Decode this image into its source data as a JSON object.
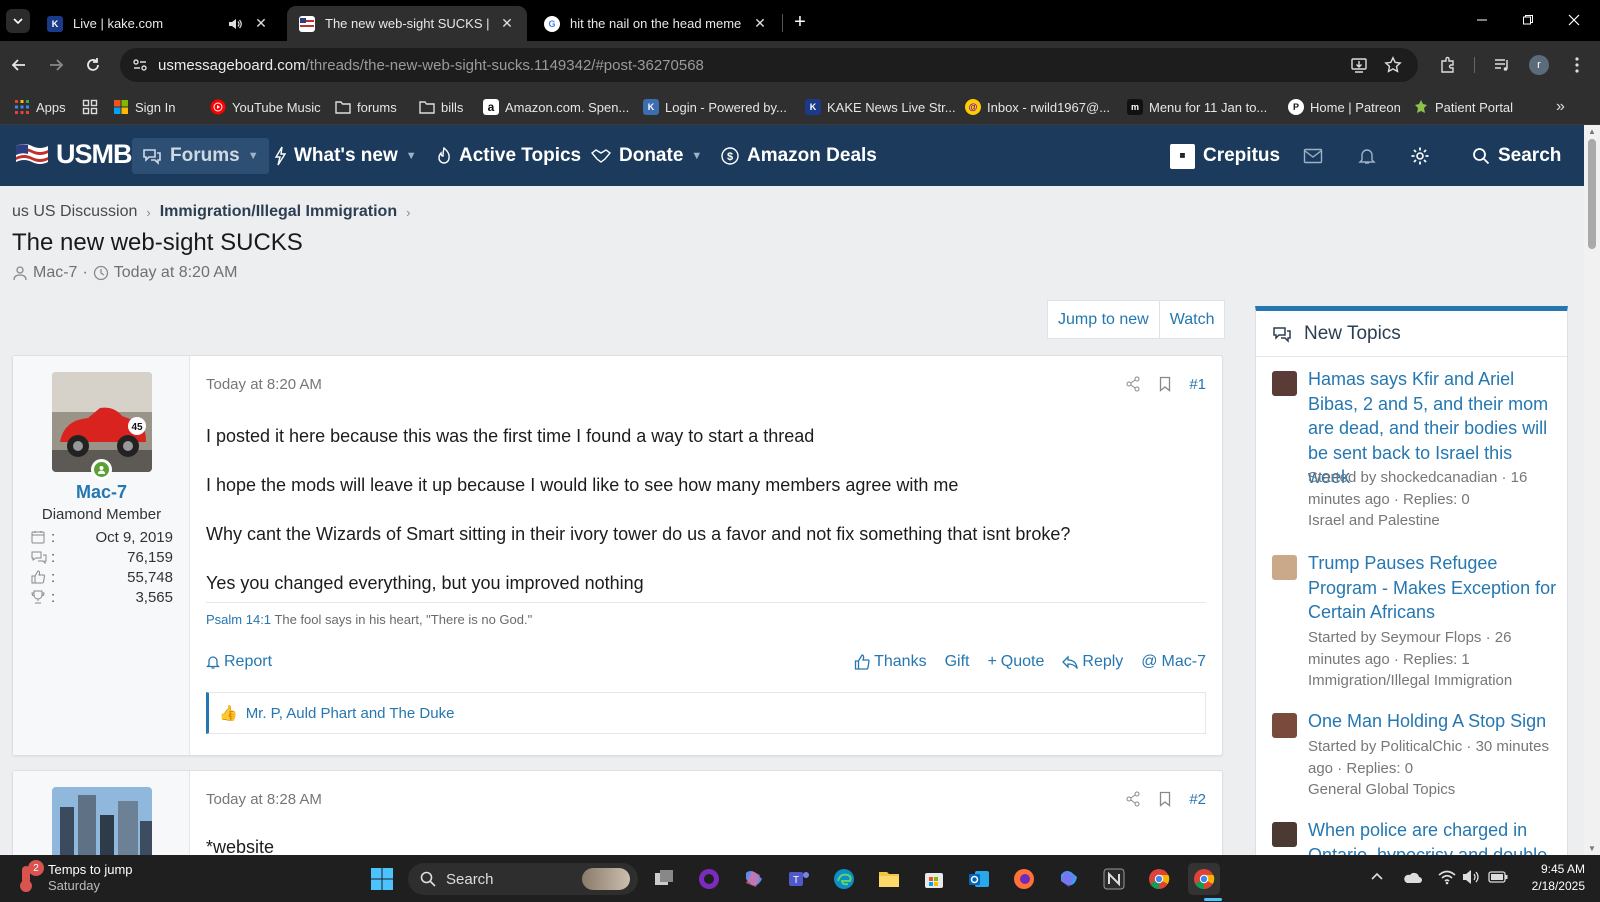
{
  "browser": {
    "tabs": [
      {
        "title": "Live | kake.com",
        "active": false
      },
      {
        "title": "The new web-sight SUCKS | US",
        "active": true
      },
      {
        "title": "hit the nail on the head meme",
        "active": false
      }
    ],
    "url": {
      "host": "usmessageboard.com",
      "path": "/threads/the-new-web-sight-sucks.1149342/#post-36270568"
    },
    "avatar_letter": "r",
    "bookmarks": [
      "Apps",
      "Sign In",
      "YouTube Music",
      "forums",
      "bills",
      "Amazon.com. Spen...",
      "Login - Powered by...",
      "KAKE News Live Str...",
      "Inbox - rwild1967@...",
      "Menu for 11 Jan to...",
      "Home | Patreon",
      "Patient Portal"
    ]
  },
  "site": {
    "logo": "USMB",
    "nav": {
      "forums": "Forums",
      "whats_new": "What's new",
      "active_topics": "Active Topics",
      "donate": "Donate",
      "amazon_deals": "Amazon Deals",
      "user": "Crepitus",
      "search": "Search"
    }
  },
  "breadcrumb": {
    "item1": "us US Discussion",
    "item2": "Immigration/Illegal Immigration"
  },
  "thread": {
    "title": "The new web-sight SUCKS",
    "author": "Mac-7",
    "date": "Today at 8:20 AM",
    "actions": {
      "jump": "Jump to new",
      "watch": "Watch"
    }
  },
  "posts": [
    {
      "username": "Mac-7",
      "user_title": "Diamond Member",
      "stats": {
        "joined": "Oct 9, 2019",
        "messages": "76,159",
        "reactions": "55,748",
        "points": "3,565"
      },
      "date": "Today at 8:20 AM",
      "number": "#1",
      "body": [
        "I posted it here because this was the first time I found a way to start a thread",
        "I hope the mods will leave it up because I would like to see how many members agree with me",
        "Why cant the Wizards of Smart sitting in their ivory tower do us a favor and not fix something that isnt broke?",
        "Yes you changed everything, but you improved nothing"
      ],
      "signature": {
        "ref": "Psalm 14:1",
        "text": "The fool says in his heart, \"There is no God.\""
      },
      "actions": {
        "report": "Report",
        "thanks": "Thanks",
        "gift": "Gift",
        "quote": "Quote",
        "reply": "Reply",
        "mention": "Mac-7"
      },
      "reactions": "Mr. P, Auld Phart and The Duke"
    },
    {
      "date": "Today at 8:28 AM",
      "number": "#2",
      "body": [
        "*website"
      ]
    }
  ],
  "sidebar": {
    "title": "New Topics",
    "topics": [
      {
        "title": "Hamas says Kfir and Ariel Bibas, 2 and 5, and their mom are dead, and their bodies will be sent back to Israel this week",
        "meta": "Started by shockedcanadian · 16 minutes ago · Replies: 0",
        "forum": "Israel and Palestine"
      },
      {
        "title": "Trump Pauses Refugee Program - Makes Exception for Certain Africans",
        "meta": "Started by Seymour Flops · 26 minutes ago · Replies: 1",
        "forum": "Immigration/Illegal Immigration"
      },
      {
        "title": "One Man Holding A Stop Sign",
        "meta": "Started by PoliticalChic · 30 minutes ago · Replies: 0",
        "forum": "General Global Topics"
      },
      {
        "title": "When police are charged in Ontario, hypocrisy and double",
        "meta": "",
        "forum": ""
      }
    ]
  },
  "taskbar": {
    "weather_title": "Temps to jump",
    "weather_sub": "Saturday",
    "weather_badge": "2",
    "search": "Search",
    "time": "9:45 AM",
    "date": "2/18/2025"
  }
}
